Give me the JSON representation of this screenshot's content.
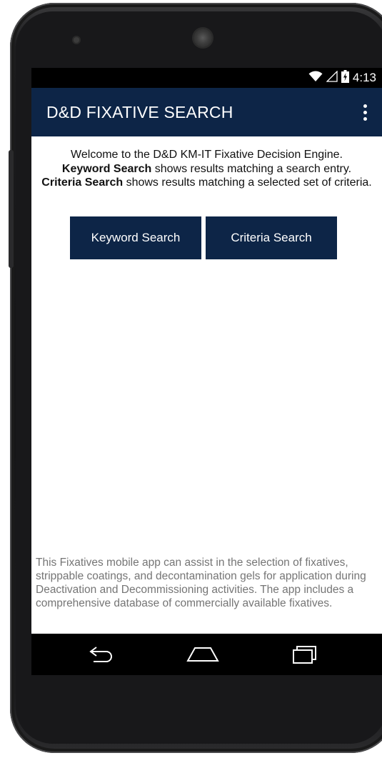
{
  "status_bar": {
    "time": "4:13",
    "icons": [
      "wifi-icon",
      "signal-icon",
      "battery-icon"
    ]
  },
  "app_bar": {
    "title": "D&D FIXATIVE SEARCH",
    "menu_icon": "overflow-menu-icon"
  },
  "welcome": {
    "line1": "Welcome to the D&D KM-IT Fixative Decision Engine.",
    "keyword_bold": "Keyword Search",
    "keyword_rest": " shows results matching a search entry.",
    "criteria_bold": "Criteria Search",
    "criteria_rest": " shows results matching a selected set of criteria."
  },
  "buttons": {
    "keyword_search": "Keyword Search",
    "criteria_search": "Criteria Search"
  },
  "footer": {
    "text": "This Fixatives mobile app can assist in the selection of fixatives, strippable coatings, and decontamination gels for application during Deactivation and Decommissioning activities. The app includes a comprehensive database of commercially available fixatives."
  },
  "nav_bar": {
    "icons": [
      "back-icon",
      "home-icon",
      "recents-icon"
    ]
  },
  "colors": {
    "primary": "#0d2547",
    "status_bar": "#000000",
    "footer_text": "#757575"
  }
}
